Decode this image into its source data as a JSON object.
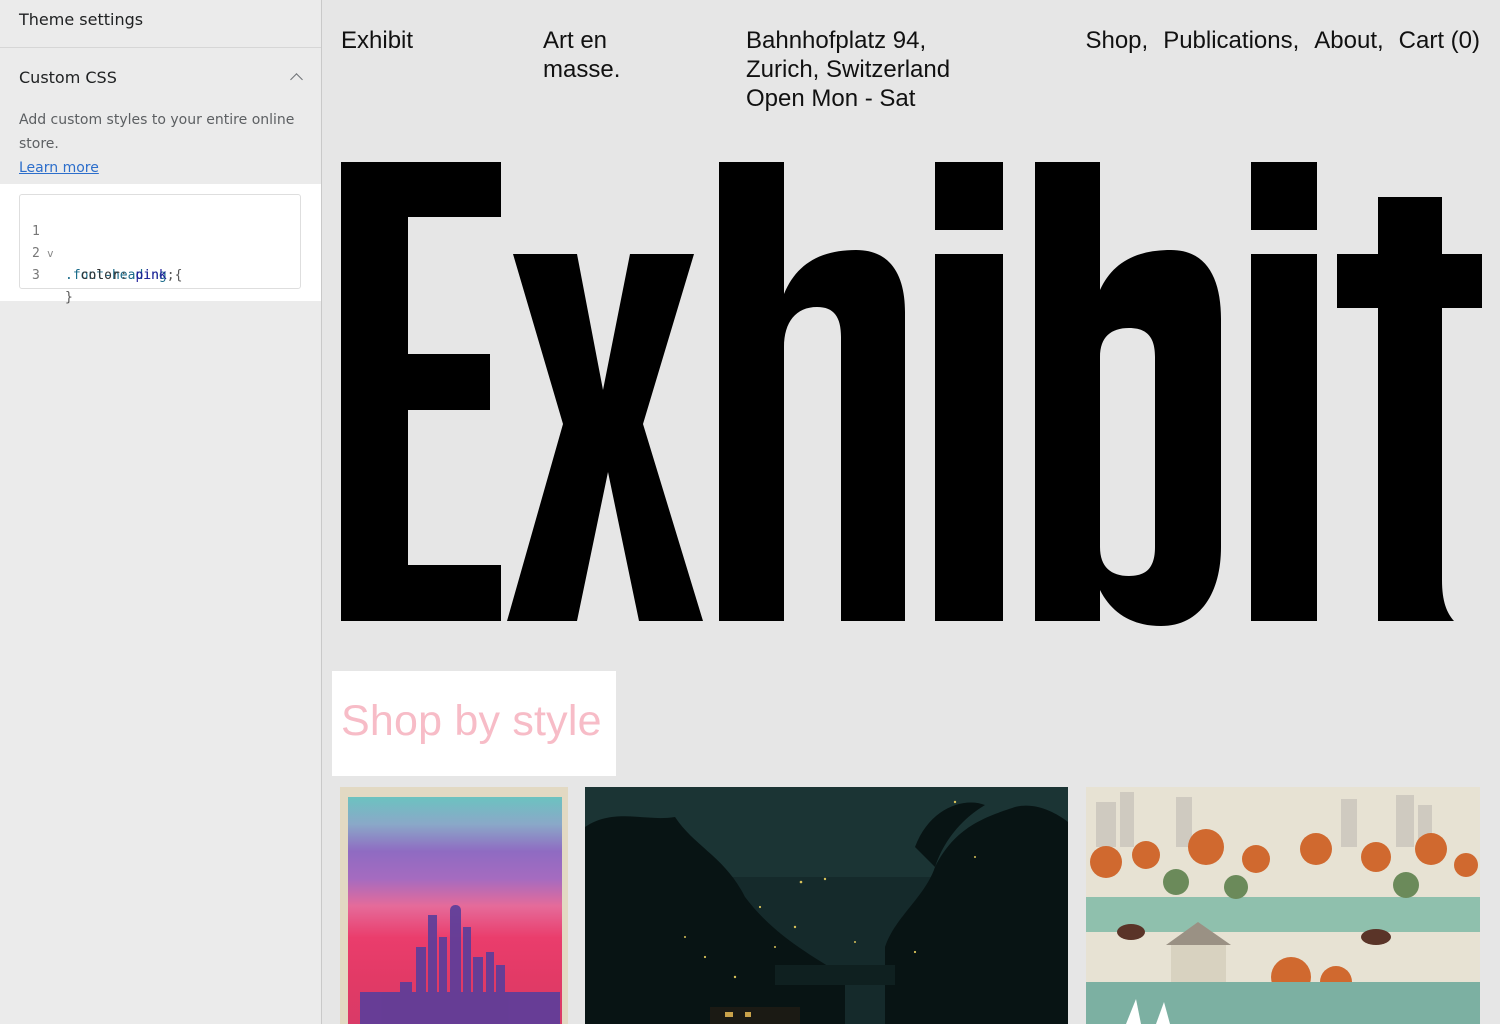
{
  "sidebar": {
    "header": "Theme settings",
    "section_title": "Custom CSS",
    "description": "Add custom styles to your entire online store.",
    "learn_more": "Learn more",
    "code_lines": [
      {
        "num": "1",
        "fold": "v",
        "selector": ".font-heading",
        "brace": " {"
      },
      {
        "num": "2",
        "property": "  color",
        "colon": ": ",
        "value": "pink",
        "semi": ";"
      },
      {
        "num": "3",
        "close": "}"
      }
    ]
  },
  "preview": {
    "brand": "Exhibit",
    "tagline": "Art en masse.",
    "address": "Bahnhofplatz 94, Zurich, Switzerland Open Mon - Sat",
    "menu": [
      "Shop,",
      "Publications,",
      "About,",
      "Cart (0)"
    ],
    "hero_title": "Exhibit",
    "section_heading": "Shop by style",
    "heading_color": "#f7bcc7",
    "images": [
      "watercolor-city-skyline",
      "night-river-landscape",
      "folk-art-park-scene"
    ]
  }
}
